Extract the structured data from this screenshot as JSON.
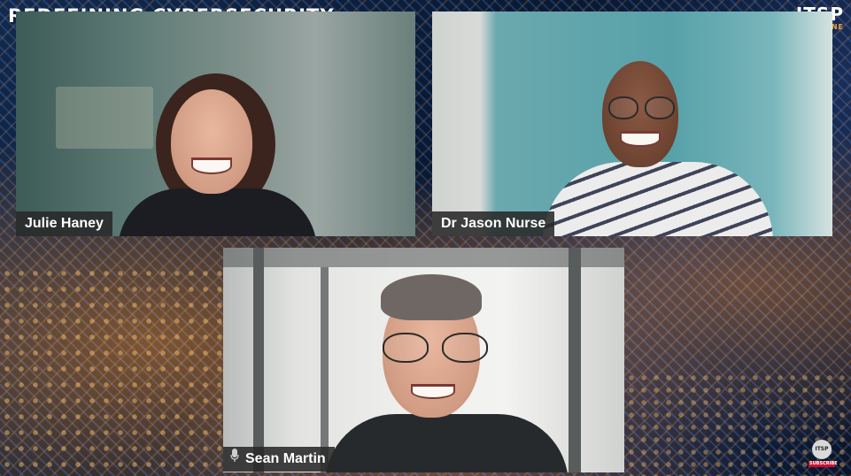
{
  "show": {
    "title": "REDEFINING CYBERSECURITY",
    "logo_main": "ITSP",
    "logo_sub": "MAGAZINE"
  },
  "participants": [
    {
      "name": "Julie Haney"
    },
    {
      "name": "Dr Jason Nurse"
    },
    {
      "name": "Sean Martin"
    }
  ],
  "subscribe": {
    "logo": "ITSP",
    "label": "SUBSCRIBE"
  },
  "colors": {
    "accent": "#f3a13a",
    "tag_bg": "#282828",
    "subscribe_red": "#c8102e"
  },
  "icons": {
    "mic": "microphone-icon"
  }
}
